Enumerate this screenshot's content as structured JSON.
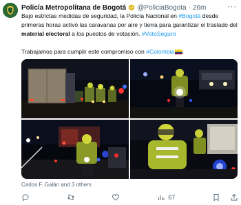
{
  "tweet": {
    "author_name": "Policía Metropolitana de Bogotá",
    "handle": "@PoliciaBogota",
    "separator": "·",
    "time": "26m",
    "body": {
      "t1": "Bajo estrictas medidas de seguridad, la Policía Nacional en ",
      "l1": "#Bogotá",
      "t2": " desde primeras horas activó las caravanas por aire y tierra para garantizar el traslado del ",
      "b1": "material electoral",
      "t3": " a los puestos de votación. ",
      "l2": "#VotoSeguro",
      "t4": "Trabajamos para cumplir este compromiso con ",
      "l3": "#Colombia"
    },
    "tagged": "Carlos F. Galán and 3 others",
    "stats": {
      "views": "67"
    }
  },
  "icons": {
    "avatar": "police-shield-logo",
    "verified": "verified-badge-icon",
    "more": "more-options-icon",
    "reply": "reply-icon",
    "retweet": "retweet-icon",
    "like": "like-icon",
    "views": "views-icon",
    "bookmark": "bookmark-icon",
    "share": "share-icon"
  },
  "colors": {
    "link": "#1d9bf0",
    "verified": "#e2b719",
    "muted": "#536471",
    "text": "#0f1419"
  }
}
